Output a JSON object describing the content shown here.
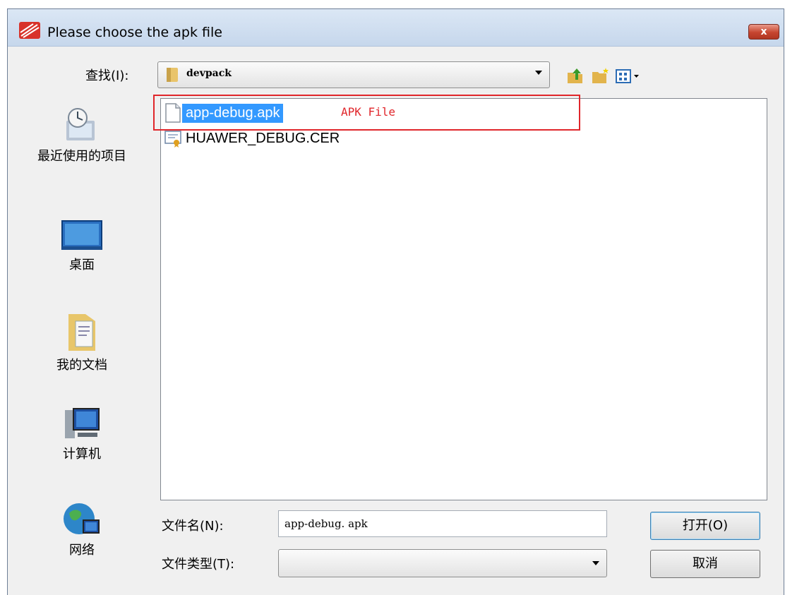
{
  "window": {
    "title": "Please choose the apk file",
    "close_label": "x"
  },
  "toolbar": {
    "look_in_label": "查找(I):",
    "current_folder": "devpack",
    "icons": [
      "up-folder-icon",
      "new-folder-icon",
      "view-menu-icon"
    ]
  },
  "places": [
    {
      "label": "最近使用的项目",
      "icon": "recent-items-icon"
    },
    {
      "label": "桌面",
      "icon": "desktop-icon"
    },
    {
      "label": "我的文档",
      "icon": "my-documents-icon"
    },
    {
      "label": "计算机",
      "icon": "computer-icon"
    },
    {
      "label": "网络",
      "icon": "network-icon"
    }
  ],
  "files": [
    {
      "name": "app-debug.apk",
      "icon": "file-icon",
      "selected": true
    },
    {
      "name": "HUAWER_DEBUG.CER",
      "icon": "certificate-icon",
      "selected": false
    }
  ],
  "annotation": {
    "text": "APK File",
    "color": "#e0262b"
  },
  "filename": {
    "label": "文件名(N):",
    "value": "app-debug. apk"
  },
  "filetype": {
    "label": "文件类型(T):",
    "value": ""
  },
  "buttons": {
    "open": "打开(O)",
    "cancel": "取消"
  },
  "colors": {
    "selection": "#3399ff",
    "titlebar": "#c6d7ec"
  }
}
